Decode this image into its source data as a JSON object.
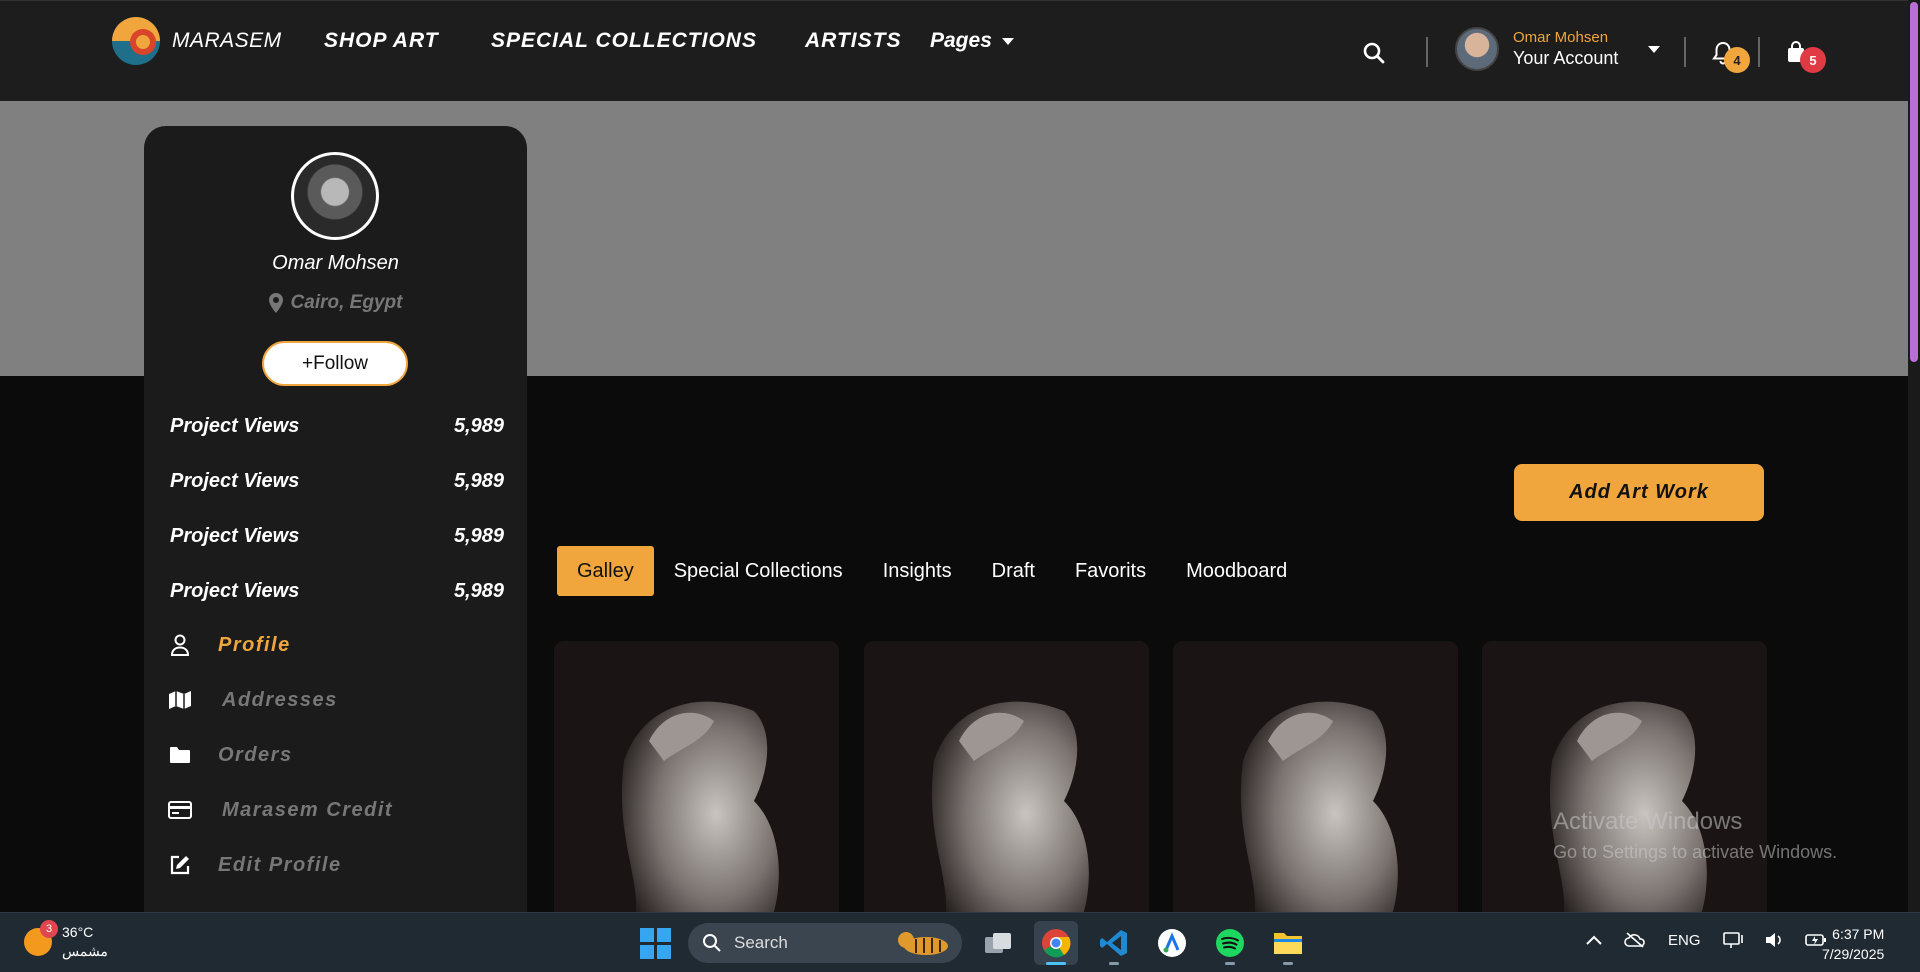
{
  "header": {
    "brand": "MARASEM",
    "nav": [
      "SHOP ART",
      "SPECIAL COLLECTIONS",
      "ARTISTS"
    ],
    "pages_label": "Pages",
    "account_name": "Omar Mohsen",
    "account_label": "Your Account",
    "notifications_count": "4",
    "cart_count": "5",
    "colors": {
      "accent": "#f0a63d",
      "badge_red": "#e03a44",
      "bar": "#1d1d1d"
    }
  },
  "profile": {
    "name": "Omar Mohsen",
    "location": "Cairo, Egypt",
    "follow_label": "+Follow",
    "stats": [
      {
        "label": "Project Views",
        "value": "5,989"
      },
      {
        "label": "Project Views",
        "value": "5,989"
      },
      {
        "label": "Project Views",
        "value": "5,989"
      },
      {
        "label": "Project Views",
        "value": "5,989"
      }
    ],
    "menu": [
      {
        "label": "Profile",
        "icon": "user-icon"
      },
      {
        "label": "Addresses",
        "icon": "map-icon"
      },
      {
        "label": "Orders",
        "icon": "folder-icon"
      },
      {
        "label": "Marasem Credit",
        "icon": "credit-card-icon"
      },
      {
        "label": "Edit Profile",
        "icon": "edit-icon"
      }
    ]
  },
  "main": {
    "add_button": "Add Art Work",
    "tabs": [
      "Galley",
      "Special Collections",
      "Insights",
      "Draft",
      "Favorits",
      "Moodboard"
    ],
    "active_tab": "Galley",
    "artwork_count": 4
  },
  "watermark": {
    "line1": "Activate Windows",
    "line2": "Go to Settings to activate Windows."
  },
  "taskbar": {
    "weather_badge": "3",
    "temperature": "36°C",
    "condition": "مشمس",
    "search_placeholder": "Search",
    "language": "ENG",
    "time": "6:37 PM",
    "date": "7/29/2025"
  }
}
